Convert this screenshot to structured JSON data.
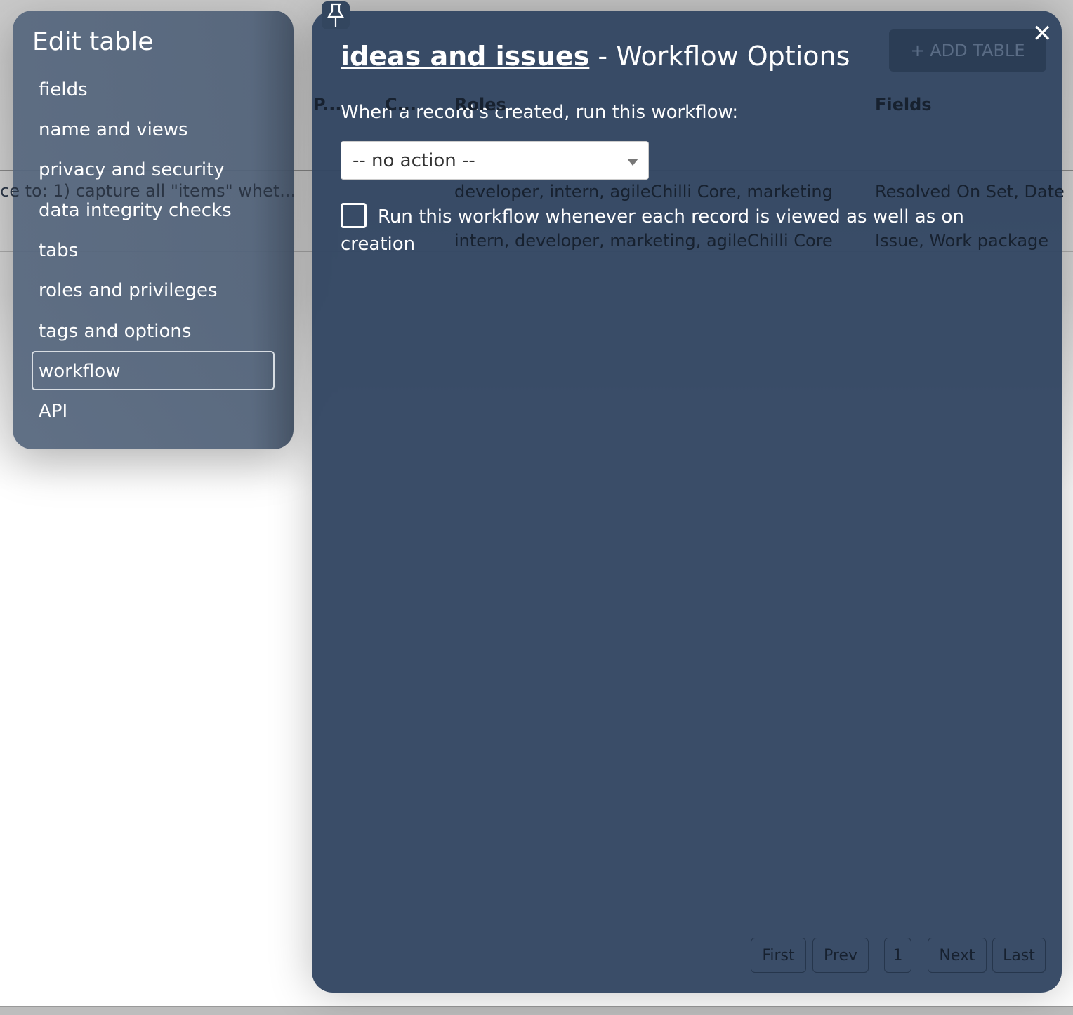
{
  "background": {
    "row_text": "ce to: 1) capture all \"items\" whet...",
    "headers": [
      "P...",
      "C...",
      "Roles",
      "Fields"
    ],
    "rows": [
      {
        "roles": "developer, intern, agileChilli Core, marketing",
        "fields": "Resolved On Set, Date"
      },
      {
        "roles": "intern, developer, marketing, agileChilli Core",
        "fields": "Issue, Work package"
      }
    ],
    "add_table": "+ ADD TABLE",
    "pager": [
      "First",
      "Prev",
      "1",
      "Next",
      "Last"
    ]
  },
  "sidebar": {
    "title": "Edit table",
    "items": [
      {
        "label": "fields"
      },
      {
        "label": "name and views"
      },
      {
        "label": "privacy and security"
      },
      {
        "label": "data integrity checks"
      },
      {
        "label": "tabs"
      },
      {
        "label": "roles and privileges"
      },
      {
        "label": "tags and options"
      },
      {
        "label": "workflow",
        "active": true
      },
      {
        "label": "API"
      }
    ]
  },
  "dialog": {
    "table_name": "ideas and issues",
    "title_suffix": " - Workflow Options",
    "create_label": "When a record's created, run this workflow:",
    "workflow_select": "-- no action --",
    "run_on_view_checked": false,
    "run_on_view_label": "Run this workflow whenever each record is viewed as well as on creation",
    "close_icon": "close-icon",
    "pin_icon": "pin-icon"
  },
  "colors": {
    "dialog_bg": "#32465f",
    "sidebar_bg": "#55667d"
  }
}
